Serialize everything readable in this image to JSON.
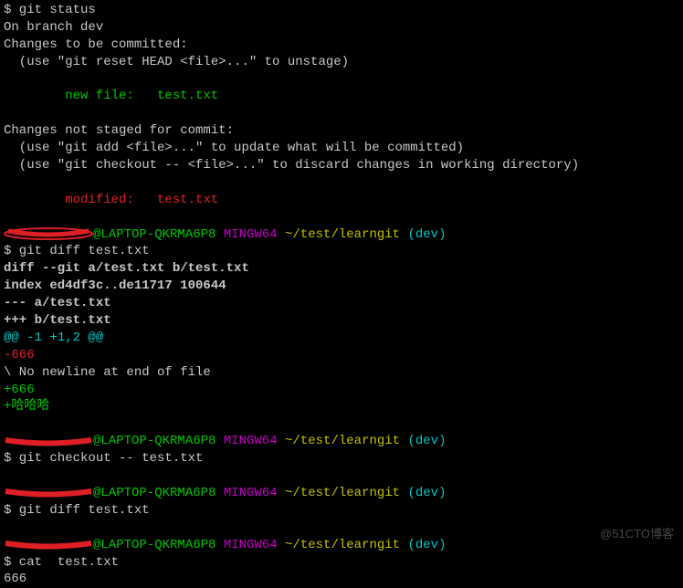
{
  "header_line": "$ git status",
  "status": {
    "branch": "On branch dev",
    "to_commit": "Changes to be committed:",
    "unstage_hint": "  (use \"git reset HEAD <file>...\" to unstage)",
    "new_file": "        new file:   test.txt",
    "not_staged": "Changes not staged for commit:",
    "add_hint": "  (use \"git add <file>...\" to update what will be committed)",
    "checkout_hint": "  (use \"git checkout -- <file>...\" to discard changes in working directory)",
    "modified": "        modified:   test.txt"
  },
  "prompt": {
    "host": "@LAPTOP-QKRMA6P8",
    "shell": " MINGW64",
    "path": " ~/test/learngit",
    "branch": " (dev)"
  },
  "cmd_diff": "$ git diff test.txt",
  "diff": {
    "header": "diff --git a/test.txt b/test.txt",
    "index": "index ed4df3c..de11717 100644",
    "minus": "--- a/test.txt",
    "plus": "+++ b/test.txt",
    "hunk": "@@ -1 +1,2 @@",
    "del": "-666",
    "nonl": "\\ No newline at end of file",
    "add1": "+666",
    "add2": "+哈哈哈"
  },
  "cmd_checkout": "$ git checkout -- test.txt",
  "cmd_diff2": "$ git diff test.txt",
  "cmd_cat": "$ cat  test.txt",
  "cat_out": "666",
  "watermark": "@51CTO博客"
}
